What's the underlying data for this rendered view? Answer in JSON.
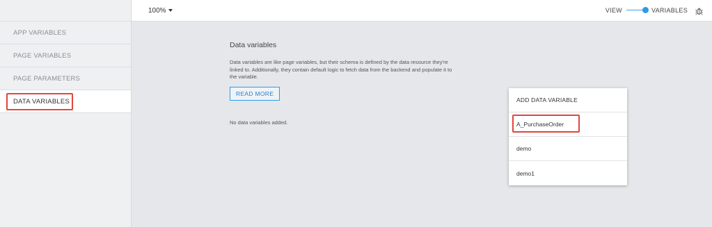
{
  "topbar": {
    "zoom": "100%",
    "view_label": "VIEW",
    "variables_label": "VARIABLES"
  },
  "sidebar": {
    "items": [
      {
        "label": "APP VARIABLES"
      },
      {
        "label": "PAGE VARIABLES"
      },
      {
        "label": "PAGE PARAMETERS"
      },
      {
        "label": "DATA VARIABLES",
        "active": true
      }
    ]
  },
  "main": {
    "title": "Data variables",
    "description": "Data variables are like page variables, but their schema is defined by the data resource they're linked to. Additionally, they contain default logic to fetch data from the backend and populate it to the variable.",
    "read_more": "READ MORE",
    "empty_message": "No data variables added."
  },
  "dropdown": {
    "header": "ADD DATA VARIABLE",
    "items": [
      "A_PurchaseOrder",
      "demo",
      "demo1"
    ]
  },
  "colors": {
    "accent": "#2d9be8",
    "highlight": "#e2453c"
  }
}
